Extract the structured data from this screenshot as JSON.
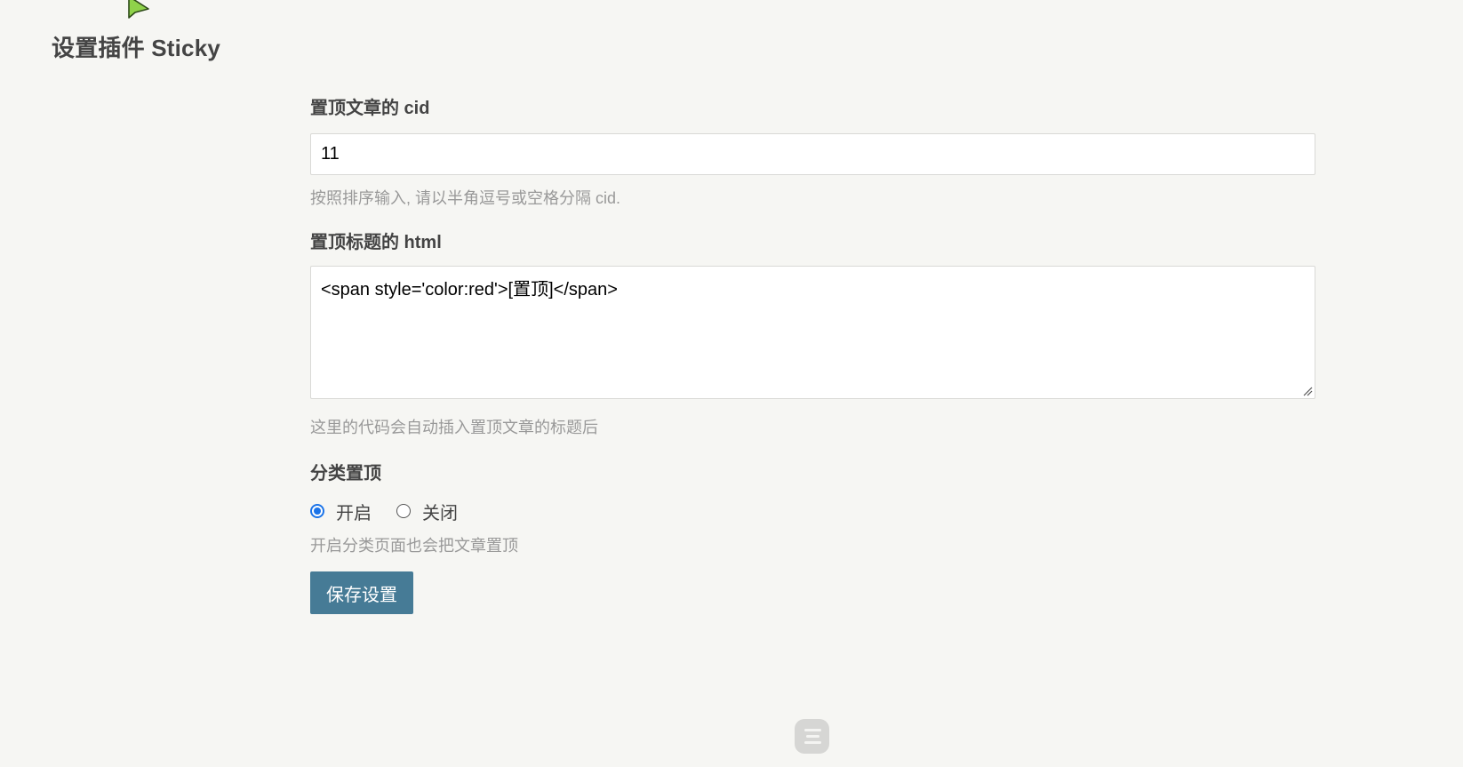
{
  "page": {
    "title": "设置插件 Sticky"
  },
  "form": {
    "cid_field": {
      "label": "置顶文章的 cid",
      "value": "11",
      "description": "按照排序输入, 请以半角逗号或空格分隔 cid."
    },
    "html_field": {
      "label": "置顶标题的 html",
      "value": "<span style='color:red'>[置顶]</span>",
      "description": "这里的代码会自动插入置顶文章的标题后"
    },
    "category_field": {
      "label": "分类置顶",
      "options": [
        {
          "label": "开启",
          "checked": true
        },
        {
          "label": "关闭",
          "checked": false
        }
      ],
      "description": "开启分类页面也会把文章置顶"
    },
    "save_label": "保存设置"
  },
  "colors": {
    "background": "#f6f6f3",
    "button": "#467b96",
    "radio_checked": "#1a73e8",
    "description_text": "#999999"
  },
  "icons": {
    "cursor": "mouse-cursor-icon",
    "floating": "menu-lines-icon"
  }
}
